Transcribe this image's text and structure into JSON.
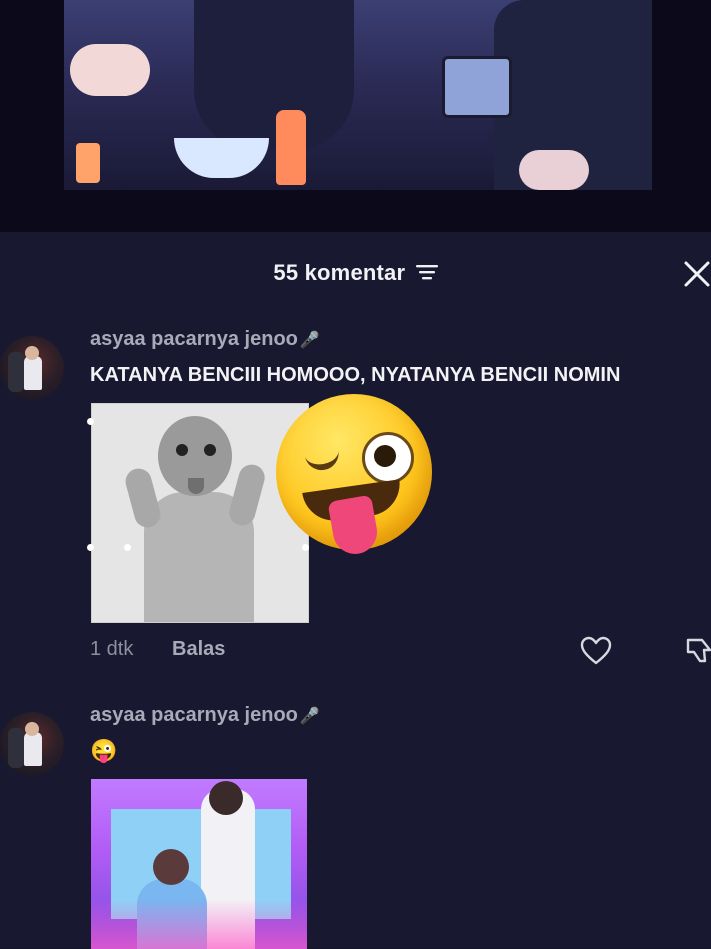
{
  "sheet": {
    "comment_count_label": "55 komentar",
    "icons": {
      "filter": "filter-lines-icon",
      "close": "close-icon"
    }
  },
  "comments": [
    {
      "username": "asyaa pacarnya jenoo",
      "username_badge": "🎤",
      "text": "KATANYA BENCIII HOMOOO, NYATANYA BENCII NOMIN",
      "attachment": "baby-peace-sign-sticker",
      "sticker": "winking-face-with-tongue",
      "time": "1 dtk",
      "reply_label": "Balas"
    },
    {
      "username": "asyaa pacarnya jenoo",
      "username_badge": "🎤",
      "text": "😜",
      "attachment": "concert-photo"
    }
  ],
  "colors": {
    "sheet_background": "#181830",
    "username": "#a9a9b8",
    "comment_text": "#f3f3f6",
    "meta": "#8e8e9c"
  }
}
